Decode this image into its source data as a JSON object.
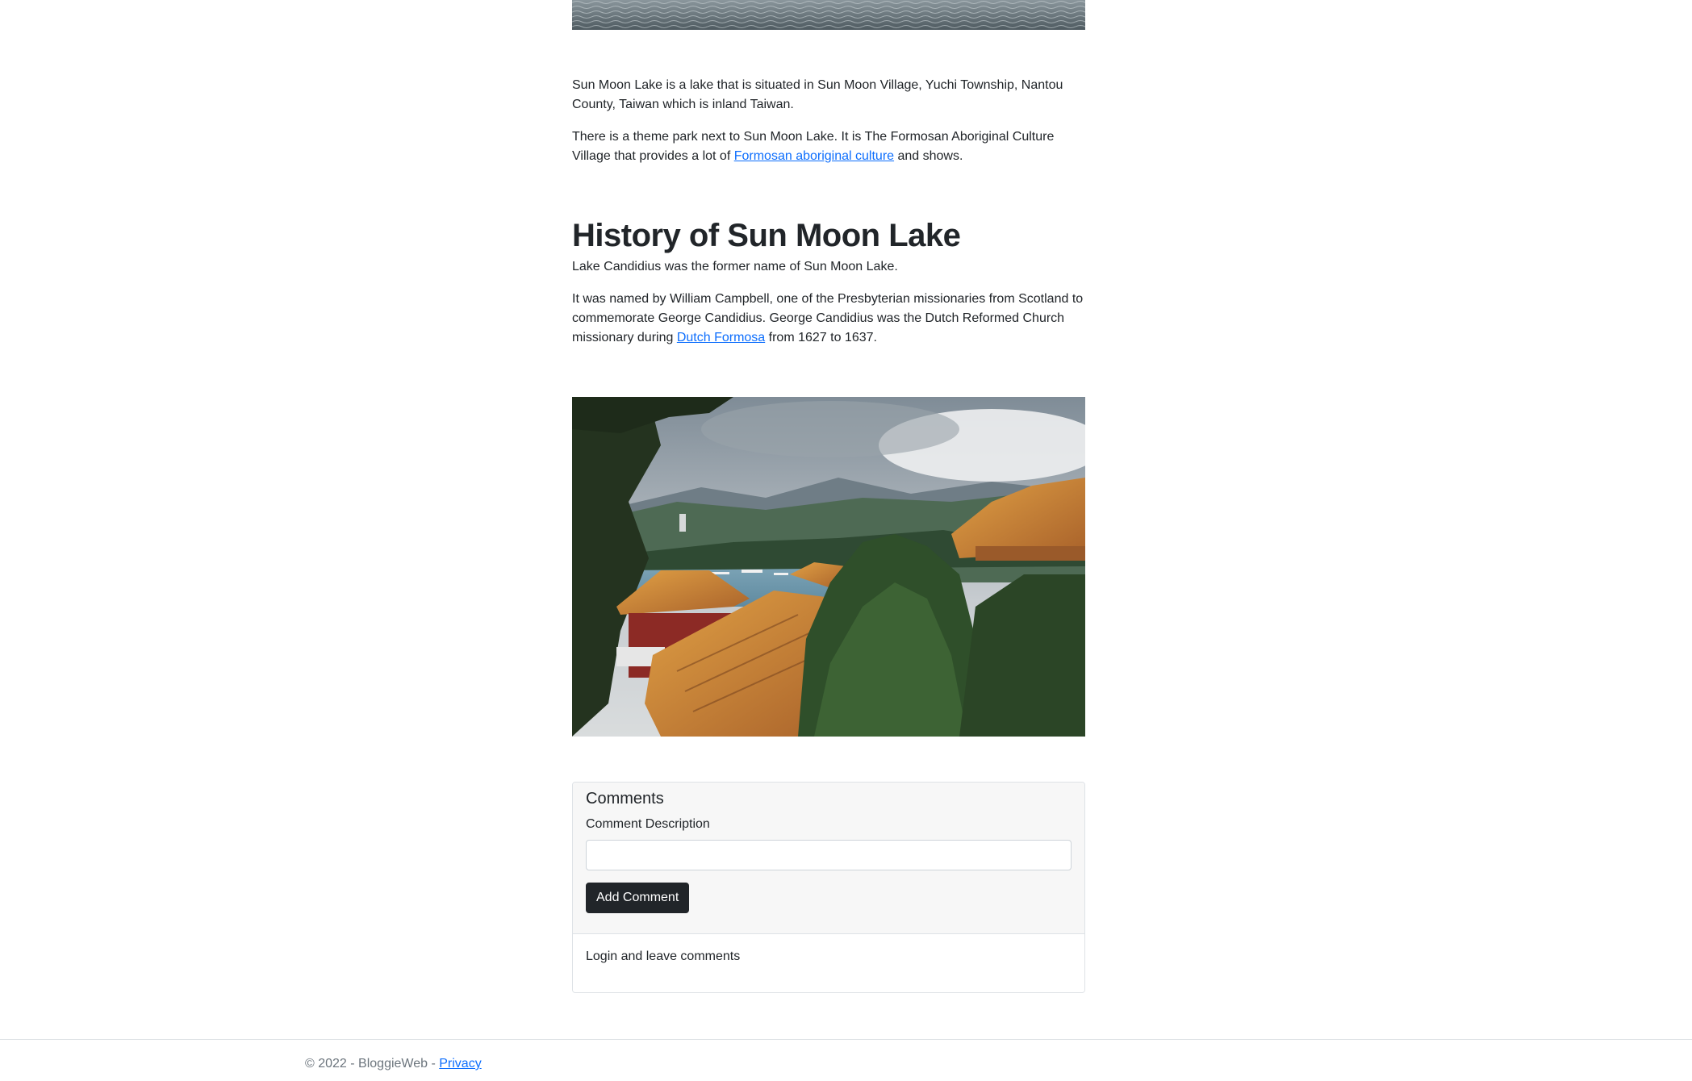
{
  "article": {
    "p1": "Sun Moon Lake is a lake that is situated in Sun Moon Village, Yuchi Township, Nantou County, Taiwan which is inland Taiwan.",
    "p2_before": "There is a theme park next to Sun Moon Lake. It is The Formosan Aboriginal Culture Village that provides a lot of ",
    "p2_link": "Formosan aboriginal culture",
    "p2_after": " and shows.",
    "heading": "History of Sun Moon Lake",
    "p3": "Lake Candidius was the former name of Sun Moon Lake.",
    "p4_before": "It was named by William Campbell, one of the Presbyterian missionaries from Scotland to commemorate George Candidius. George Candidius was the Dutch Reformed Church missionary during ",
    "p4_link": "Dutch Formosa",
    "p4_after": " from 1627 to 1637."
  },
  "comments": {
    "title": "Comments",
    "label": "Comment Description",
    "input_value": "",
    "button_label": "Add Comment",
    "login_note": "Login and leave comments"
  },
  "footer": {
    "copyright": "© 2022 - BloggieWeb - ",
    "privacy_link": "Privacy"
  },
  "colors": {
    "link": "#0d6efd",
    "button_bg": "#212529",
    "card_header_bg": "#f7f7f7"
  }
}
